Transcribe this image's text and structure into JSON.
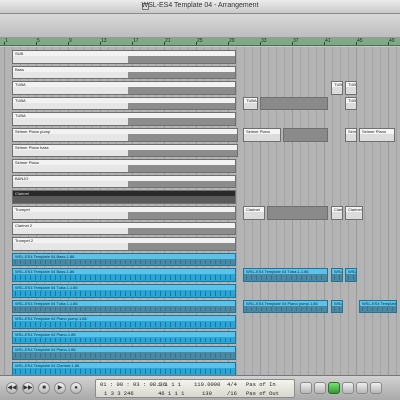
{
  "window": {
    "title": "WSL-ES4 Template 04 - Arrangement"
  },
  "ruler": {
    "bars": [
      "1",
      "5",
      "9",
      "13",
      "17",
      "21",
      "25",
      "29",
      "33",
      "37",
      "41",
      "45",
      "49"
    ]
  },
  "tracks": [
    {
      "name": "SUB",
      "type": "audio"
    },
    {
      "name": "Bass",
      "type": "audio"
    },
    {
      "name": "TUBA",
      "type": "audio"
    },
    {
      "name": "TUBA",
      "type": "audio"
    },
    {
      "name": "TUBA",
      "type": "audio"
    },
    {
      "name": "Selmer Piano pump",
      "type": "audio"
    },
    {
      "name": "Selmer Piano bass",
      "type": "audio"
    },
    {
      "name": "Selmer Piano",
      "type": "audio"
    },
    {
      "name": "BANJO",
      "type": "audio"
    },
    {
      "name": "Clarinet",
      "type": "audio"
    },
    {
      "name": "Trumpet",
      "type": "audio"
    },
    {
      "name": "Clarinet 2",
      "type": "audio"
    },
    {
      "name": "Trumpet 2",
      "type": "audio"
    },
    {
      "name": "WSL-ES4 Template 04 Bass.1.86",
      "type": "midi"
    },
    {
      "name": "WSL-ES4 Template 04 Bass.1.86",
      "type": "midi"
    },
    {
      "name": "WSL-ES4 Template 04 Tuba.1.1.86",
      "type": "midi"
    },
    {
      "name": "WSL-ES4 Template 04 Tuba.1.1.86",
      "type": "midi"
    },
    {
      "name": "WSL-ES4 Template 04 Piano pump.1.86",
      "type": "midi"
    },
    {
      "name": "WSL-ES4 Template 04 Piano.1.86",
      "type": "midi"
    },
    {
      "name": "WSL-ES4 Template 04 Piano.1.86",
      "type": "midi"
    },
    {
      "name": "WSL-ES4 Template 04 Clarinet.1.86",
      "type": "midi"
    }
  ],
  "side_regions": [
    {
      "name": "TUBA"
    },
    {
      "name": "TUBA"
    },
    {
      "name": "TUBA"
    },
    {
      "name": "TUBA"
    },
    {
      "name": "Selmer Piano"
    },
    {
      "name": "Selmer"
    },
    {
      "name": "Selmer Piano"
    },
    {
      "name": "Clarinet"
    },
    {
      "name": "Clarinet"
    },
    {
      "name": "Clarinet"
    },
    {
      "name": "WSL-ES4 Template 04 Tuba.1.1.86"
    },
    {
      "name": "WSL"
    },
    {
      "name": "WSL"
    },
    {
      "name": "WSL-ES4 Template 04 Piano pump.1.86"
    },
    {
      "name": "WSL"
    },
    {
      "name": "WSL-ES4 Template"
    }
  ],
  "transport": {
    "position_time": "01 : 00 : 03 : 08.36",
    "position_bars": "1 3 3 246",
    "bar_top": "1 1 1 1",
    "bar_bottom": "46 1 1 1",
    "tempo": "110.0000",
    "tempo_sub": "130",
    "signature": "4/4",
    "division": "/16",
    "in_label": "Pas of In",
    "out_label": "Pas of Out",
    "buttons": [
      "◀◀",
      "▶▶",
      "■",
      "▶",
      "●"
    ]
  },
  "colors": {
    "ruler": "#7eaa88",
    "midi_region": "#29a6d8",
    "audio_region": "#e6e6e6",
    "record_green": "#2f9b2f"
  }
}
